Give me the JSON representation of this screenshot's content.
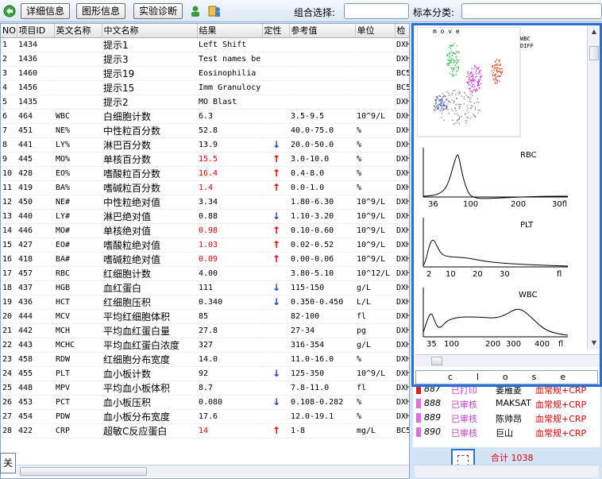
{
  "toolbar": {
    "detail_label": "详细信息",
    "graph_label": "图形信息",
    "diag_label": "实验诊断",
    "group_label": "组合选择:",
    "group_value": "",
    "sample_class_label": "标本分类:",
    "sample_class_value": ""
  },
  "table": {
    "headers": [
      "NO",
      "项目ID",
      "英文名称",
      "中文名称",
      "结果",
      "定性",
      "参考值",
      "单位",
      "检"
    ],
    "rows": [
      {
        "no": "1",
        "id": "1434",
        "en": "",
        "cn": "提示1",
        "result": "Left Shift",
        "flag": "",
        "ref": "",
        "unit": "",
        "dev": "DXH",
        "high": false
      },
      {
        "no": "2",
        "id": "1436",
        "en": "",
        "cn": "提示3",
        "result": "Test names be",
        "flag": "",
        "ref": "",
        "unit": "",
        "dev": "DXH",
        "high": false
      },
      {
        "no": "3",
        "id": "1460",
        "en": "",
        "cn": "提示19",
        "result": "Eosinophilia",
        "flag": "",
        "ref": "",
        "unit": "",
        "dev": "BC5",
        "high": false
      },
      {
        "no": "4",
        "id": "1456",
        "en": "",
        "cn": "提示15",
        "result": "Imm Granulocy",
        "flag": "",
        "ref": "",
        "unit": "",
        "dev": "BC5",
        "high": false
      },
      {
        "no": "5",
        "id": "1435",
        "en": "",
        "cn": "提示2",
        "result": "MO Blast",
        "flag": "",
        "ref": "",
        "unit": "",
        "dev": "DXH",
        "high": false
      },
      {
        "no": "6",
        "id": "464",
        "en": "WBC",
        "cn": "白细胞计数",
        "result": "6.3",
        "flag": "",
        "ref": "3.5-9.5",
        "unit": "10^9/L",
        "dev": "DXH",
        "high": false
      },
      {
        "no": "7",
        "id": "451",
        "en": "NE%",
        "cn": "中性粒百分数",
        "result": "52.8",
        "flag": "",
        "ref": "40.0-75.0",
        "unit": "%",
        "dev": "DXH",
        "high": false
      },
      {
        "no": "8",
        "id": "441",
        "en": "LY%",
        "cn": "淋巴百分数",
        "result": "13.9",
        "flag": "↓",
        "ref": "20.0-50.0",
        "unit": "%",
        "dev": "DXH",
        "high": false
      },
      {
        "no": "9",
        "id": "445",
        "en": "MO%",
        "cn": "单核百分数",
        "result": "15.5",
        "flag": "↑",
        "ref": "3.0-10.0",
        "unit": "%",
        "dev": "DXH",
        "high": true
      },
      {
        "no": "10",
        "id": "428",
        "en": "EO%",
        "cn": "嗜酸粒百分数",
        "result": "16.4",
        "flag": "↑",
        "ref": "0.4-8.0",
        "unit": "%",
        "dev": "DXH",
        "high": true
      },
      {
        "no": "11",
        "id": "419",
        "en": "BA%",
        "cn": "嗜碱粒百分数",
        "result": "1.4",
        "flag": "↑",
        "ref": "0.0-1.0",
        "unit": "%",
        "dev": "DXH",
        "high": true
      },
      {
        "no": "12",
        "id": "450",
        "en": "NE#",
        "cn": "中性粒绝对值",
        "result": "3.34",
        "flag": "",
        "ref": "1.80-6.30",
        "unit": "10^9/L",
        "dev": "DXH",
        "high": false
      },
      {
        "no": "13",
        "id": "440",
        "en": "LY#",
        "cn": "淋巴绝对值",
        "result": "0.88",
        "flag": "↓",
        "ref": "1.10-3.20",
        "unit": "10^9/L",
        "dev": "DXH",
        "high": false
      },
      {
        "no": "14",
        "id": "446",
        "en": "MO#",
        "cn": "单核绝对值",
        "result": "0.98",
        "flag": "↑",
        "ref": "0.10-0.60",
        "unit": "10^9/L",
        "dev": "DXH",
        "high": true
      },
      {
        "no": "15",
        "id": "427",
        "en": "EO#",
        "cn": "嗜酸粒绝对值",
        "result": "1.03",
        "flag": "↑",
        "ref": "0.02-0.52",
        "unit": "10^9/L",
        "dev": "DXH",
        "high": true
      },
      {
        "no": "16",
        "id": "418",
        "en": "BA#",
        "cn": "嗜碱粒绝对值",
        "result": "0.09",
        "flag": "↑",
        "ref": "0.00-0.06",
        "unit": "10^9/L",
        "dev": "DXH",
        "high": true
      },
      {
        "no": "17",
        "id": "457",
        "en": "RBC",
        "cn": "红细胞计数",
        "result": "4.00",
        "flag": "",
        "ref": "3.80-5.10",
        "unit": "10^12/L",
        "dev": "DXH",
        "high": false
      },
      {
        "no": "18",
        "id": "437",
        "en": "HGB",
        "cn": "血红蛋白",
        "result": "111",
        "flag": "↓",
        "ref": "115-150",
        "unit": "g/L",
        "dev": "DXH",
        "high": false
      },
      {
        "no": "19",
        "id": "436",
        "en": "HCT",
        "cn": "红细胞压积",
        "result": "0.340",
        "flag": "↓",
        "ref": "0.350-0.450",
        "unit": "L/L",
        "dev": "DXH",
        "high": false
      },
      {
        "no": "20",
        "id": "444",
        "en": "MCV",
        "cn": "平均红细胞体积",
        "result": "85",
        "flag": "",
        "ref": "82-100",
        "unit": "fl",
        "dev": "DXH",
        "high": false
      },
      {
        "no": "21",
        "id": "442",
        "en": "MCH",
        "cn": "平均血红蛋白量",
        "result": "27.8",
        "flag": "",
        "ref": "27-34",
        "unit": "pg",
        "dev": "DXH",
        "high": false
      },
      {
        "no": "22",
        "id": "443",
        "en": "MCHC",
        "cn": "平均血红蛋白浓度",
        "result": "327",
        "flag": "",
        "ref": "316-354",
        "unit": "g/L",
        "dev": "DXH",
        "high": false
      },
      {
        "no": "23",
        "id": "458",
        "en": "RDW",
        "cn": "红细胞分布宽度",
        "result": "14.0",
        "flag": "",
        "ref": "11.0-16.0",
        "unit": "%",
        "dev": "DXH",
        "high": false
      },
      {
        "no": "24",
        "id": "455",
        "en": "PLT",
        "cn": "血小板计数",
        "result": "92",
        "flag": "↓",
        "ref": "125-350",
        "unit": "10^9/L",
        "dev": "DXH",
        "high": false
      },
      {
        "no": "25",
        "id": "448",
        "en": "MPV",
        "cn": "平均血小板体积",
        "result": "8.7",
        "flag": "",
        "ref": "7.8-11.0",
        "unit": "fl",
        "dev": "DXH",
        "high": false
      },
      {
        "no": "26",
        "id": "453",
        "en": "PCT",
        "cn": "血小板压积",
        "result": "0.080",
        "flag": "↓",
        "ref": "0.108-0.282",
        "unit": "%",
        "dev": "DXH",
        "high": false
      },
      {
        "no": "27",
        "id": "454",
        "en": "PDW",
        "cn": "血小板分布宽度",
        "result": "17.6",
        "flag": "",
        "ref": "12.0-19.1",
        "unit": "%",
        "dev": "DXH",
        "high": false
      },
      {
        "no": "28",
        "id": "422",
        "en": "CRP",
        "cn": "超敏C反应蛋白",
        "result": "14",
        "flag": "↑",
        "ref": "1-8",
        "unit": "mg/L",
        "dev": "BC5",
        "high": true
      }
    ]
  },
  "bottom": {
    "close_label": "关",
    "total_label": "合计",
    "total_value": "1038"
  },
  "graphs": {
    "scatter_title": "m o v e",
    "scatter_legend": [
      "WBC",
      "DIFF"
    ],
    "rbc_label": "RBC",
    "rbc_ticks": [
      "36",
      "100",
      "200",
      "30fl"
    ],
    "plt_label": "PLT",
    "plt_ticks": [
      "2",
      "10",
      "20",
      "30",
      "fl"
    ],
    "wbc_label": "WBC",
    "wbc_ticks": [
      "35",
      "100",
      "200",
      "300",
      "400",
      "fl"
    ],
    "close_text": "close"
  },
  "samples": [
    {
      "no": "887",
      "status": "已打印",
      "name": "姜雁菱",
      "item": "血常规+CRP",
      "mark_color": "#e02020"
    },
    {
      "no": "888",
      "status": "已审核",
      "name": "MAKSAT",
      "item": "血常规+CRP",
      "mark_color": "#e070e0"
    },
    {
      "no": "889",
      "status": "已审核",
      "name": "陈帅昂",
      "item": "血常规+CRP",
      "mark_color": "#e070e0"
    },
    {
      "no": "890",
      "status": "已审核",
      "name": "巨山",
      "item": "血常规+CRP",
      "mark_color": "#e070e0"
    }
  ],
  "colors": {
    "high": "#e00000",
    "low": "#1a3fd0",
    "panel_border": "#2b6fd6",
    "status_pink": "#d040d0"
  }
}
